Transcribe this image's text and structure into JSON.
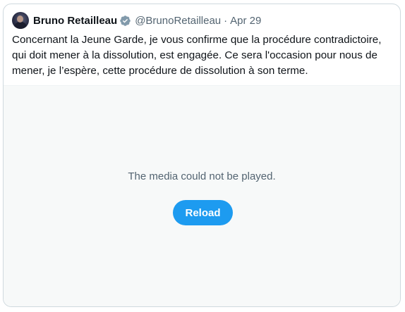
{
  "tweet": {
    "author_name": "Bruno Retailleau",
    "handle": "@BrunoRetailleau",
    "separator": "·",
    "date": "Apr 29",
    "text_lines": [
      "Concernant la Jeune Garde, je vous confirme que la procédure contradictoire,",
      "qui doit mener à la dissolution, est engagée. Ce sera l'occasion pour nous de",
      "mener, je l’espère, cette procédure de dissolution à son terme."
    ]
  },
  "media": {
    "error_message": "The media could not be played.",
    "reload_label": "Reload"
  },
  "colors": {
    "accent": "#1d9bf0",
    "verified_badge": "#829aab",
    "secondary_text": "#536471",
    "media_background": "#f7f9f9"
  },
  "icons": {
    "verified": "verified-badge-icon",
    "avatar": "profile-avatar"
  }
}
